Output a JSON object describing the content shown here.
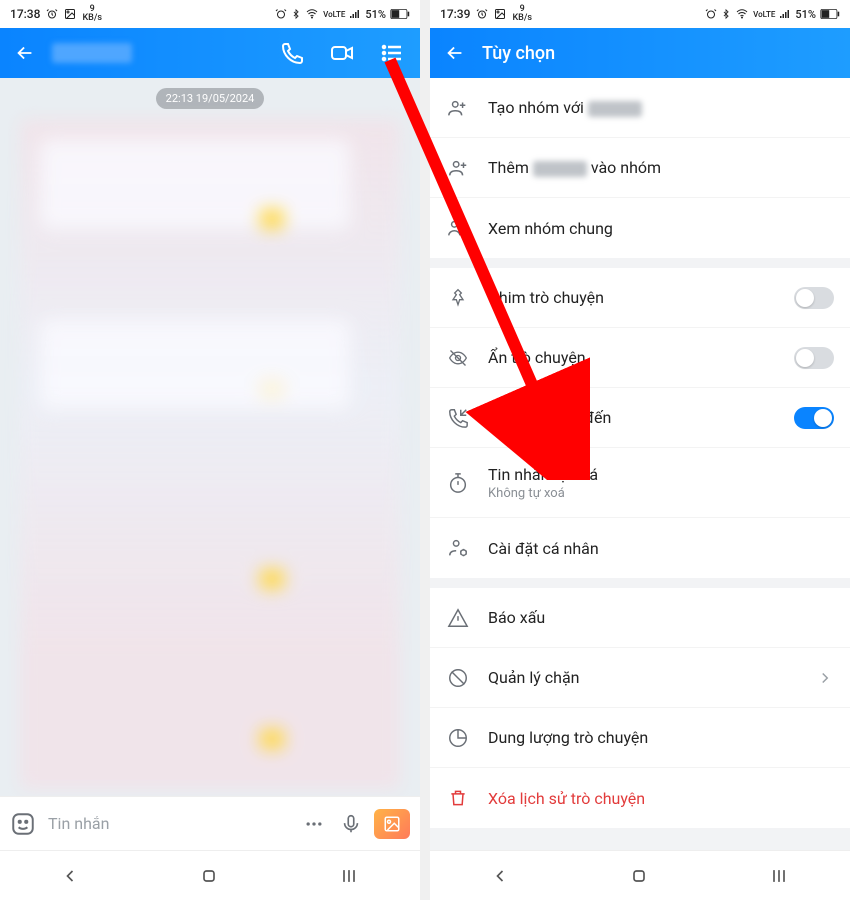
{
  "status_left": {
    "time_a": "17:38",
    "time_b": "17:39",
    "net_speed_num": "9",
    "net_speed_unit": "KB/s"
  },
  "status_right": {
    "signal_label": "VoLTE",
    "battery_pct": "51%"
  },
  "chat": {
    "date_chip": "22:13 19/05/2024",
    "input_placeholder": "Tin nhắn"
  },
  "options": {
    "title": "Tùy chọn",
    "create_group_prefix": "Tạo nhóm với ",
    "add_to_group_prefix": "Thêm ",
    "add_to_group_suffix": " vào nhóm",
    "common_groups": "Xem nhóm chung",
    "pin": "Ghim trò chuyện",
    "hide": "Ẩn trò chuyện",
    "call_notify": "Báo cuộc gọi đến",
    "auto_delete": "Tin nhắn tự xoá",
    "auto_delete_sub": "Không tự xoá",
    "personal_settings": "Cài đặt cá nhân",
    "report": "Báo xấu",
    "block": "Quản lý chặn",
    "storage": "Dung lượng trò chuyện",
    "delete_history": "Xóa lịch sử trò chuyện"
  },
  "toggles": {
    "pin": false,
    "hide": false,
    "call_notify": true
  }
}
